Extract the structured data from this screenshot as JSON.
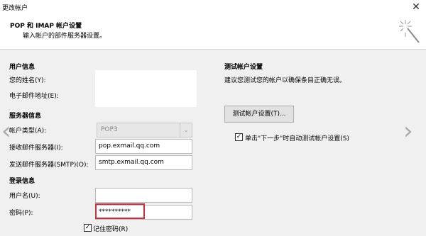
{
  "window": {
    "title": "更改帐户",
    "close_glyph": "✕"
  },
  "header": {
    "title": "POP 和 IMAP 帐户设置",
    "subtitle": "输入帐户的部件服务器设置。",
    "icon": "magic-wand-icon"
  },
  "user_info": {
    "section": "用户信息",
    "name_label": "您的姓名(Y):",
    "email_label": "电子邮件地址(E):"
  },
  "server_info": {
    "section": "服务器信息",
    "account_type_label": "帐户类型(A):",
    "account_type_value": "POP3",
    "incoming_label": "接收邮件服务器(I):",
    "incoming_value": "pop.exmail.qq.com",
    "outgoing_label": "发送邮件服务器(SMTP)(O):",
    "outgoing_value": "smtp.exmail.qq.com"
  },
  "login_info": {
    "section": "登录信息",
    "username_label": "用户名(U):",
    "username_value": "",
    "password_label": "密码(P):",
    "password_value": "**********",
    "remember_label": "记住密码(R)",
    "remember_checked": true
  },
  "test": {
    "section": "测试帐户设置",
    "description": "建议您测试您的帐户以确保条目正确无误。",
    "button_label": "测试帐户设置(T)...",
    "auto_test_label": "单击\"下一步\"时自动测试帐户设置(S)",
    "auto_test_checked": true
  },
  "nav": {
    "prev_glyph": "‹",
    "next_glyph": "›"
  },
  "colors": {
    "highlight": "#c9303b",
    "background": "#f0f0f0"
  }
}
